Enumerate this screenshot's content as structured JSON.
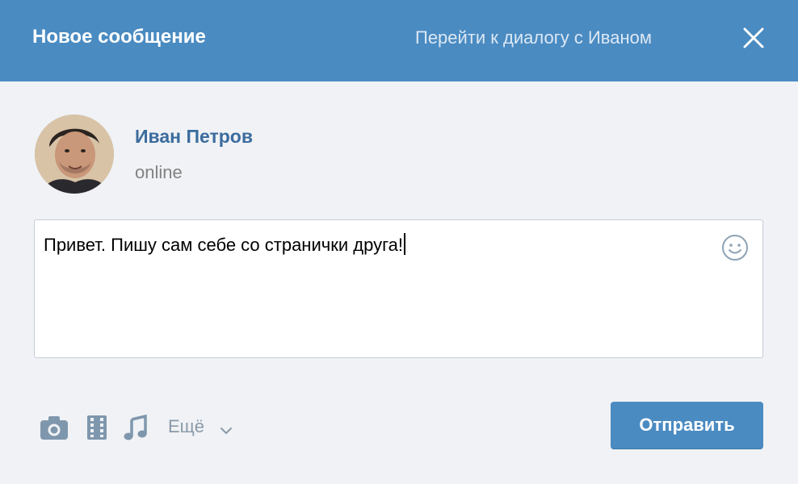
{
  "header": {
    "title": "Новое сообщение",
    "dialog_link": "Перейти к диалогу с Иваном",
    "close_icon": "close-icon"
  },
  "recipient": {
    "name": "Иван Петров",
    "status": "online",
    "avatar_icon": "user-avatar"
  },
  "composer": {
    "message": "Привет. Пишу сам себе со странички друга!",
    "emoji_icon": "smiley-icon"
  },
  "toolbar": {
    "attachments": [
      "camera-icon",
      "video-icon",
      "music-icon"
    ],
    "more_label": "Ещё",
    "send_label": "Отправить"
  },
  "colors": {
    "header_bg": "#4a8bc2",
    "name_link": "#3b6c9e",
    "send_button": "#4a8bc2",
    "panel_bg": "#f0f2f5"
  }
}
